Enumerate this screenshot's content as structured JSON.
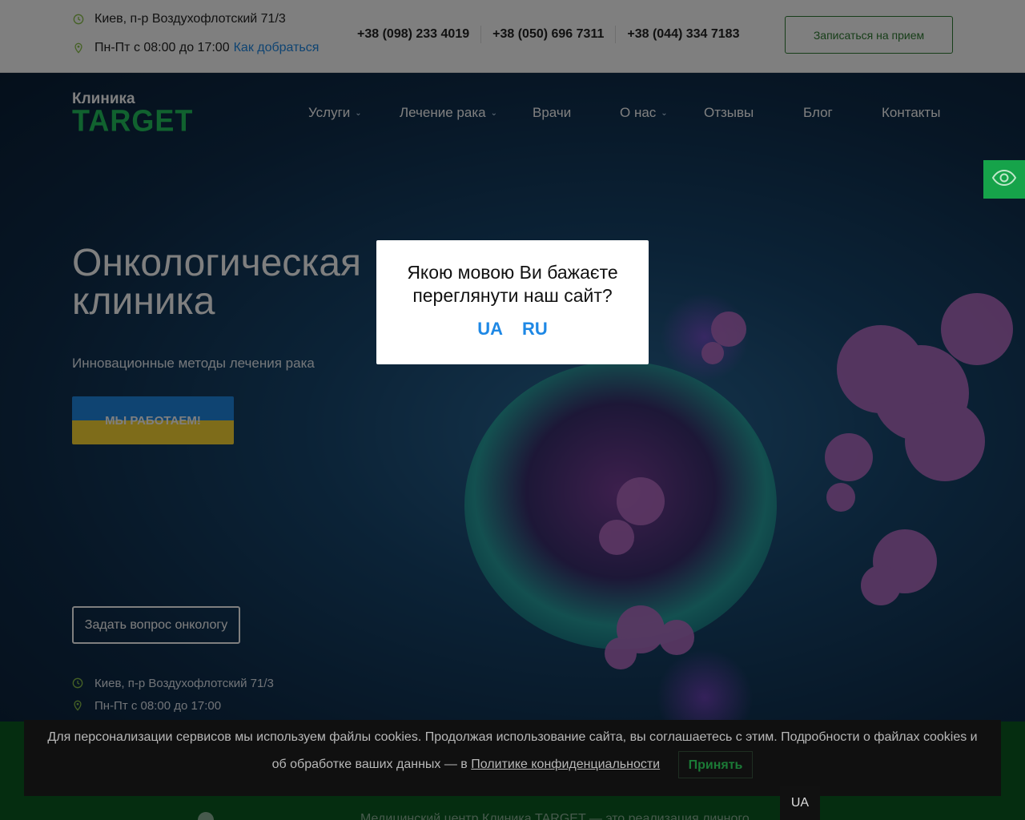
{
  "topbar": {
    "address": "Киев, п-р Воздухофлотский 71/3",
    "hours": "Пн-Пт с 08:00 до 17:00",
    "directions_link": "Как добраться",
    "phones": [
      "+38 (098) 233 4019",
      "+38 (050) 696 7311",
      "+38 (044) 334 7183"
    ],
    "book_button": "Записаться на прием"
  },
  "logo": {
    "line1": "Клиника",
    "line2": "TARGET"
  },
  "nav": {
    "items": [
      {
        "label": "Услуги",
        "dropdown": true
      },
      {
        "label": "Лечение рака",
        "dropdown": true
      },
      {
        "label": "Врачи",
        "dropdown": false
      },
      {
        "label": "О нас",
        "dropdown": true
      },
      {
        "label": "Отзывы",
        "dropdown": false
      },
      {
        "label": "Блог",
        "dropdown": false
      },
      {
        "label": "Контакты",
        "dropdown": false
      }
    ]
  },
  "hero": {
    "title": "Онкологическая клиника",
    "subtitle": "Инновационные методы лечения рака",
    "work_button": "МЫ РАБОТАЕМ!",
    "ask_button": "Задать вопрос онкологу",
    "address": "Киев, п-р Воздухофлотский 71/3",
    "hours": "Пн-Пт с 08:00 до 17:00"
  },
  "language_modal": {
    "question": "Якою мовою Ви бажаєте переглянути наш сайт?",
    "option_ua": "UA",
    "option_ru": "RU"
  },
  "cookie_banner": {
    "text": "Для персонализации сервисов мы используем файлы cookies. Продолжая использование сайта, вы соглашаетесь с этим. Подробности о файлах cookies и об обработке ваших данных — в",
    "policy_link": "Политике конфиденциальности",
    "accept_button": "Принять"
  },
  "language_tab": "UA",
  "footer": {
    "text_fragment": "Медицинский центр Клиника TARGET — это реализация личного"
  },
  "colors": {
    "brand_green": "#22c55e",
    "link_blue": "#1e88e5",
    "accent_yellow": "#fdd835"
  },
  "icons": [
    "clock-icon",
    "location-pin-icon",
    "eye-icon",
    "chevron-down-icon"
  ]
}
